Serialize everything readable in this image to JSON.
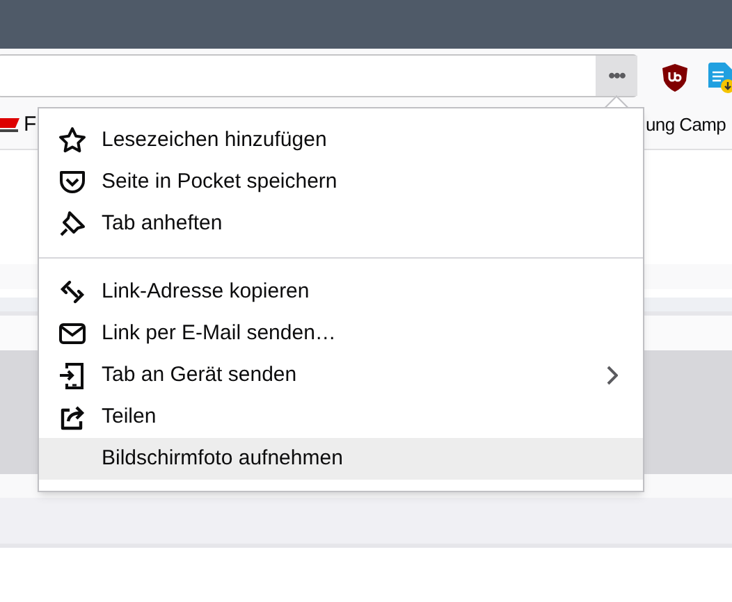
{
  "toolbar": {
    "page_actions_button": {
      "label": "•••",
      "open": true
    }
  },
  "bookmarks": [
    {
      "label": "F"
    },
    {
      "label": "ung Camp"
    }
  ],
  "menu": {
    "items": [
      {
        "kind": "item",
        "label": "Lesezeichen hinzufügen",
        "highlighted": false,
        "has_submenu": false
      },
      {
        "kind": "item",
        "label": "Seite in Pocket speichern",
        "highlighted": false,
        "has_submenu": false
      },
      {
        "kind": "item",
        "label": "Tab anheften",
        "highlighted": false,
        "has_submenu": false
      },
      {
        "kind": "separator"
      },
      {
        "kind": "item",
        "label": "Link-Adresse kopieren",
        "highlighted": false,
        "has_submenu": false
      },
      {
        "kind": "item",
        "label": "Link per E-Mail senden…",
        "highlighted": false,
        "has_submenu": false
      },
      {
        "kind": "item",
        "label": "Tab an Gerät senden",
        "highlighted": false,
        "has_submenu": true
      },
      {
        "kind": "item",
        "label": "Teilen",
        "highlighted": false,
        "has_submenu": false
      },
      {
        "kind": "item",
        "label": "Bildschirmfoto aufnehmen",
        "highlighted": true,
        "has_submenu": false
      }
    ]
  }
}
